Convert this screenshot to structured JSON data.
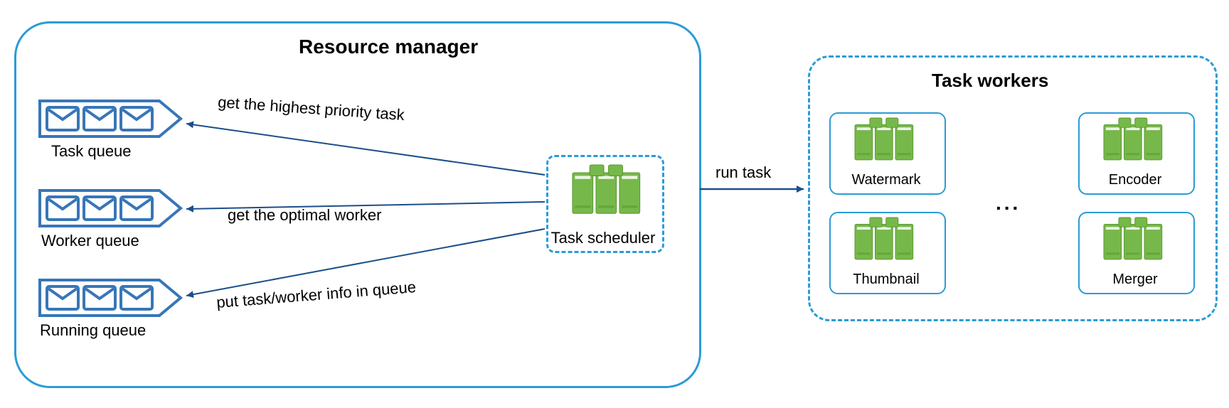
{
  "resource_manager": {
    "title": "Resource manager",
    "queues": [
      {
        "label": "Task queue"
      },
      {
        "label": "Worker queue"
      },
      {
        "label": "Running queue"
      }
    ],
    "scheduler_label": "Task scheduler",
    "edges": {
      "to_task_queue": "get the highest priority task",
      "to_worker_queue": "get the optimal worker",
      "to_running_queue": "put task/worker info in queue"
    }
  },
  "run_task_label": "run task",
  "task_workers": {
    "title": "Task workers",
    "workers": [
      {
        "label": "Watermark"
      },
      {
        "label": "Encoder"
      },
      {
        "label": "Thumbnail"
      },
      {
        "label": "Merger"
      }
    ],
    "ellipsis": "..."
  },
  "colors": {
    "blue": "#2b9bd6",
    "green": "#77b84a",
    "green_dark": "#5a9a32"
  }
}
